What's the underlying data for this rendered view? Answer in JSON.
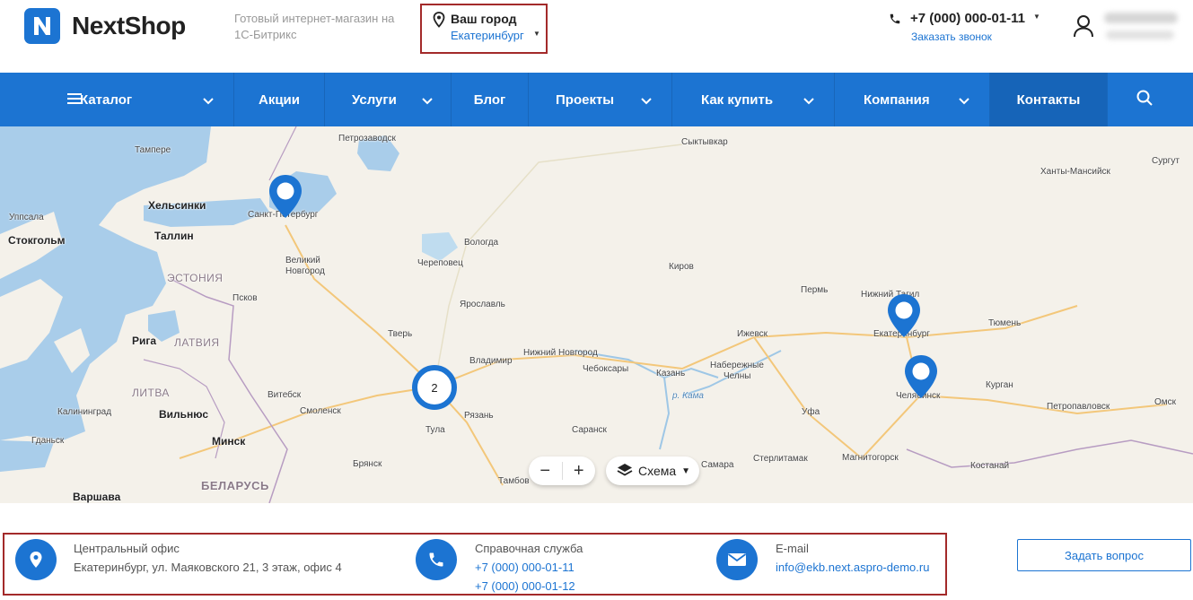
{
  "header": {
    "logo_text": "NextShop",
    "slogan": "Готовый интернет-магазин на 1С-Битрикс",
    "city_title": "Ваш город",
    "city_name": "Екатеринбург",
    "phone": "+7 (000) 000-01-11",
    "callback": "Заказать звонок",
    "brand_color": "#1c74d2"
  },
  "nav": {
    "items": [
      {
        "label": "Каталог",
        "icon": "menu-icon",
        "has_dropdown": true
      },
      {
        "label": "Акции",
        "has_dropdown": false
      },
      {
        "label": "Услуги",
        "has_dropdown": true
      },
      {
        "label": "Блог",
        "has_dropdown": false
      },
      {
        "label": "Проекты",
        "has_dropdown": true
      },
      {
        "label": "Как купить",
        "has_dropdown": true
      },
      {
        "label": "Компания",
        "has_dropdown": true
      },
      {
        "label": "Контакты",
        "has_dropdown": false,
        "active": true
      }
    ],
    "search_icon": "search-icon"
  },
  "map": {
    "cities": {
      "petrozavodsk": "Петрозаводск",
      "syktyvkar": "Сыктывкар",
      "tampere": "Тампере",
      "hanty": "Ханты-Мансийск",
      "surgut": "Сургут",
      "helsinki": "Хельсинки",
      "spb": "Санкт-Петербург",
      "uppsala": "Уппсала",
      "stockholm": "Стокгольм",
      "tallinn": "Таллин",
      "vologda": "Вологда",
      "estonia": "ЭСТОНИЯ",
      "cherepovets": "Череповец",
      "kirov": "Киров",
      "vnovgorod1": "Великий",
      "vnovgorod2": "Новгород",
      "perm": "Пермь",
      "ntagil": "Нижний Тагил",
      "pskov": "Псков",
      "yaroslavl": "Ярославль",
      "tyumen": "Тюмень",
      "ekb": "Екатеринбург",
      "riga": "Рига",
      "latvia": "ЛАТВИЯ",
      "tver": "Тверь",
      "izhevsk": "Ижевск",
      "nnovgorod": "Нижний Новгород",
      "vladimir": "Владимир",
      "cheboksary": "Чебоксары",
      "nchelny1": "Набережные",
      "nchelny2": "Челны",
      "kazan": "Казань",
      "chelyabinsk": "Челябинск",
      "kurgan": "Курган",
      "kama": "р. Кама",
      "lithuania": "ЛИТВА",
      "vitebsk": "Витебск",
      "kaliningrad": "Калининград",
      "vilnius": "Вильнюс",
      "smolensk": "Смоленск",
      "ryazan": "Рязань",
      "petropavlovsk": "Петропавловск",
      "omsk": "Омск",
      "ufa": "Уфа",
      "tula": "Тула",
      "saransk": "Саранск",
      "gdansk": "Гданьск",
      "minsk": "Минск",
      "bryansk": "Брянск",
      "samara": "Самара",
      "sterlitamak": "Стерлитамак",
      "magnitogorsk": "Магнитогорск",
      "kostanay": "Костанай",
      "warsaw": "Варшава",
      "belarus": "БЕЛАРУСЬ",
      "tambov": "Тамбов"
    },
    "cluster_count": "2",
    "layer_label": "Схема",
    "zoom_out": "−",
    "zoom_in": "+",
    "pin_color": "#1c74d2"
  },
  "contacts": {
    "office_label": "Центральный офис",
    "office_value": "Екатеринбург, ул. Маяковского 21, 3 этаж, офис 4",
    "help_label": "Справочная служба",
    "help_phone1": "+7 (000) 000-01-11",
    "help_phone2": "+7 (000) 000-01-12",
    "email_label": "E-mail",
    "email_value": "info@ekb.next.aspro-demo.ru",
    "ask_button": "Задать вопрос"
  }
}
